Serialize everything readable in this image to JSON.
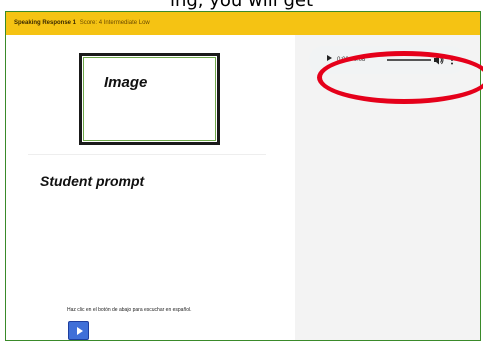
{
  "caption": "ing, you will get",
  "header": {
    "title": "Speaking Response 1",
    "score": "Score: 4 Intermediate Low"
  },
  "left_panel": {
    "image_label": "Image",
    "student_prompt": "Student prompt",
    "instruction": "Haz clic en el botón de abajo para escuchar en español.",
    "play_icon": "play-icon"
  },
  "audio_player": {
    "time": "0:00 / 0:08",
    "icons": [
      "play-icon",
      "volume-icon",
      "more-vert-icon"
    ]
  },
  "colors": {
    "header_bg": "#f5c313",
    "frame_border": "#3a8a2a",
    "play_button": "#3f6fd8",
    "highlight": "#e5001a"
  }
}
